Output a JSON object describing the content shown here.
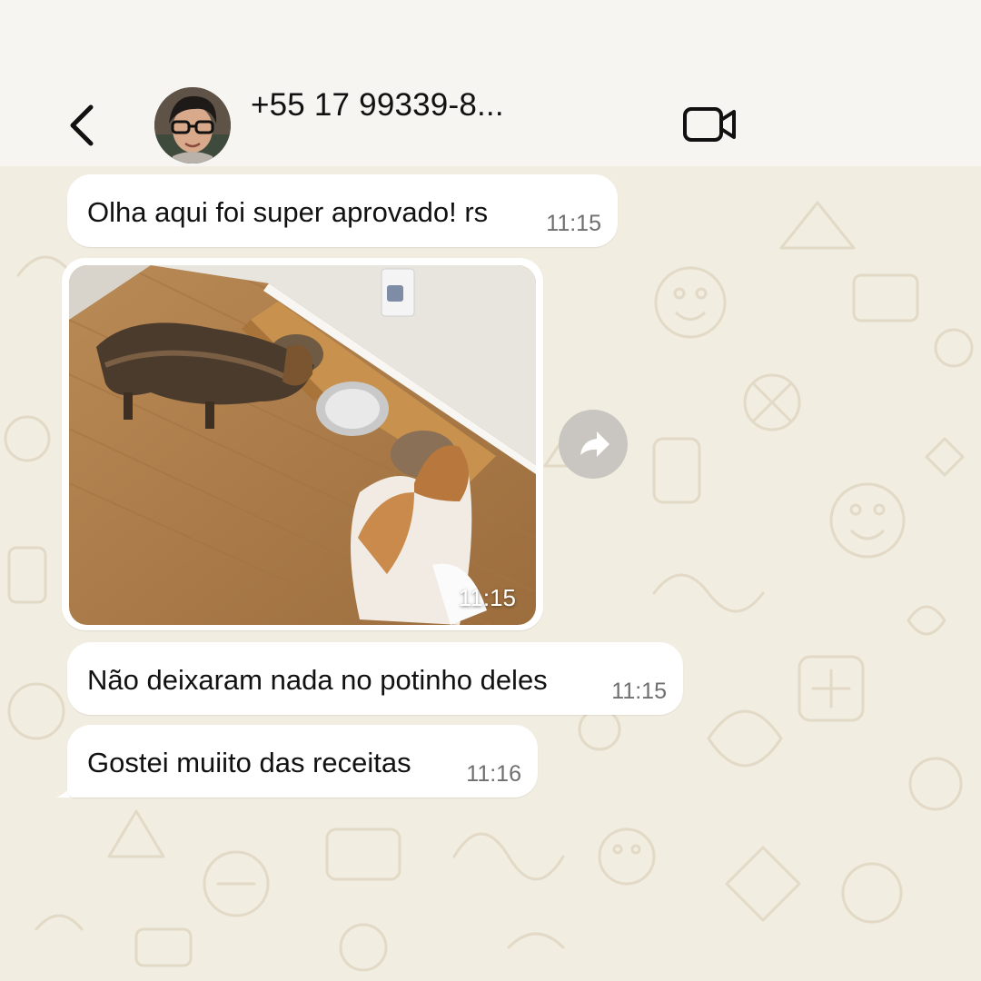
{
  "header": {
    "contact_name": "+55 17 99339-8...",
    "back_icon": "chevron-left-icon",
    "video_icon": "video-camera-icon"
  },
  "messages": [
    {
      "type": "text",
      "text": "Olha aqui foi super aprovado! rs",
      "time": "11:15"
    },
    {
      "type": "image",
      "image": "two dogs eating from raised double bowl stand",
      "time": "11:15"
    },
    {
      "type": "text",
      "text": "Não deixaram nada no potinho deles",
      "time": "11:15"
    },
    {
      "type": "text",
      "text": "Gostei muiito das receitas",
      "time": "11:16"
    }
  ],
  "colors": {
    "header_bg": "#f6f5f2",
    "wallpaper_bg": "#f2ede1",
    "bubble_bg": "#ffffff",
    "forward_button": "#c9c6c1"
  },
  "forward_icon": "forward-arrow-icon"
}
